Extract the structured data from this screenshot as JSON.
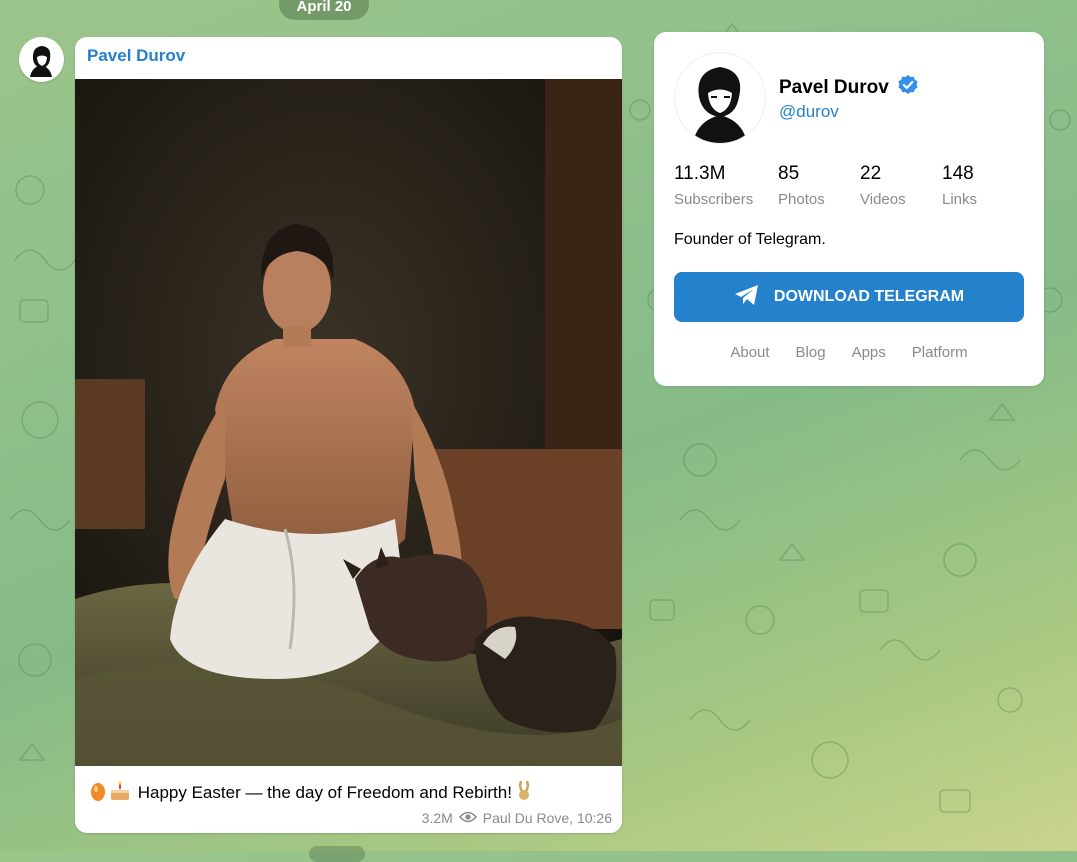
{
  "date_label": "April 20",
  "message": {
    "author": "Pavel Durov",
    "caption": "Happy Easter — the day of Freedom and Rebirth!",
    "emoji_icons": [
      "egg-icon",
      "cake-icon",
      "rabbit-icon"
    ],
    "views": "3.2M",
    "signature": "Paul Du Rove, 10:26"
  },
  "profile": {
    "name": "Pavel Durov",
    "username": "@durov",
    "verified": true,
    "stats": [
      {
        "num": "11.3M",
        "label": "Subscribers"
      },
      {
        "num": "85",
        "label": "Photos"
      },
      {
        "num": "22",
        "label": "Videos"
      },
      {
        "num": "148",
        "label": "Links"
      }
    ],
    "description": "Founder of Telegram.",
    "download_label": "DOWNLOAD TELEGRAM",
    "links": [
      "About",
      "Blog",
      "Apps",
      "Platform"
    ]
  },
  "colors": {
    "accent": "#2481cc",
    "meta_gray": "#8a8a8a",
    "background_green": "#8fc08c"
  }
}
